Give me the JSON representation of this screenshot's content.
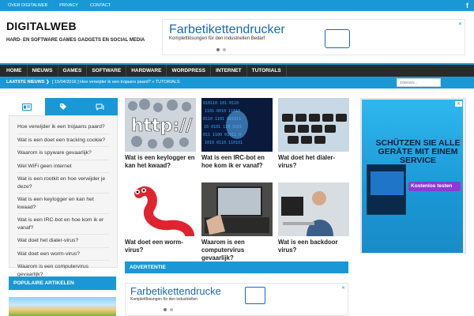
{
  "top_links": [
    "OVER DIGITALWEB",
    "PRIVACY",
    "CONTACT"
  ],
  "site": {
    "title": "DIGITALWEB",
    "tagline": "HARD- EN SOFTWARE GAMES GADGETS EN SOCIAL MEDIA"
  },
  "header_ad": {
    "title": "Farbetikettendrucker",
    "subtitle": "Komplettlösungen für den industriellen Bedarf",
    "close_mark": "✕"
  },
  "nav": [
    "HOME",
    "NIEUWS",
    "GAMES",
    "SOFTWARE",
    "HARDWARE",
    "WORDPRESS",
    "INTERNET",
    "TUTORIALS"
  ],
  "ticker": {
    "label": "LAATSTE NIEUWS ❯",
    "news": "[ 15/04/2016 ]  Hoe verwijder ik een trojaans paard?  »  TUTORIALS",
    "search_placeholder": "ZOEKEN..."
  },
  "sidebar": {
    "items": [
      "Hoe verwijder ik een trojaans paard?",
      "Wat is een doet een tracking cookie?",
      "Waarom is spyware gevaarlijk?",
      "Wel WiFi geen internet",
      "Wat is een rootkit en hoe verwijder je deze?",
      "Wat is een keylogger en kan het kwaad?",
      "Wat is een IRC-bot en hoe kom ik er vanaf?",
      "Wat doet het dialer-virus?",
      "Wat doet een worm-virus?",
      "Waarom is een computervirus gevaarlijk?"
    ],
    "popular_header": "POPULAIRE ARTIKELEN"
  },
  "articles": [
    {
      "title": "Wat is een keylogger en kan het kwaad?"
    },
    {
      "title": "Wat is een IRC-bot en hoe kom ik er vanaf?"
    },
    {
      "title": "Wat doet het dialer-virus?"
    },
    {
      "title": "Wat doet een worm-virus?"
    },
    {
      "title": "Waarom is een computervirus gevaarlijk?"
    },
    {
      "title": "Wat is een backdoor virus?"
    }
  ],
  "ad_bar": "ADVERTENTIE",
  "bottom_ad": {
    "title": "Farbetikettendrucke",
    "subtitle": "Komplettlösungen für den industriellen",
    "close_mark": "✕"
  },
  "side_ad": {
    "headline": "SCHÜTZEN SIE ALLE GERÄTE MIT EINEM SERVICE",
    "cta": "Kostenlos testen",
    "close_mark": "✕"
  },
  "colors": {
    "accent": "#1a98d5",
    "nav_bg": "#2a2a2a",
    "ad_blue": "#1a69b4",
    "cta_purple": "#8a3bd6"
  }
}
